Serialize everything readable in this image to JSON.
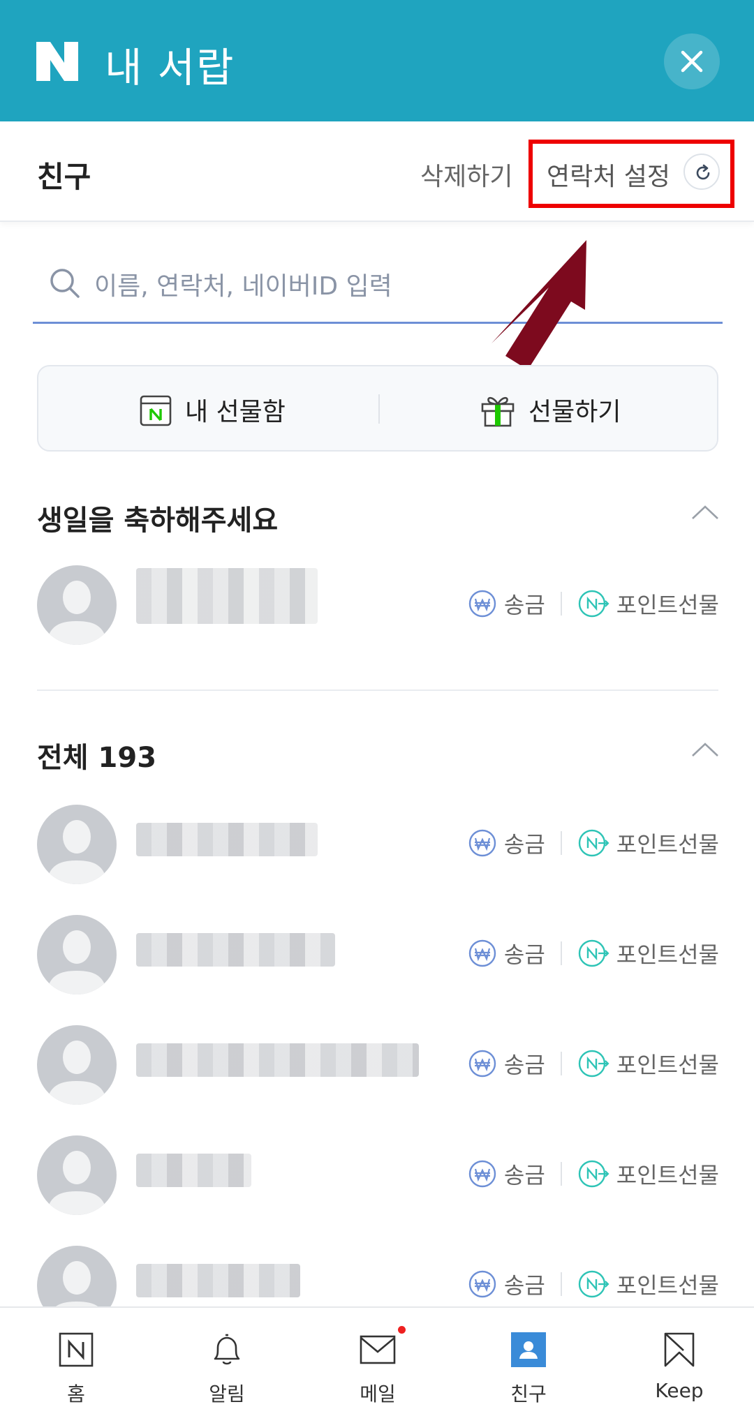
{
  "header": {
    "title": "내 서랍"
  },
  "subbar": {
    "label": "친구",
    "delete": "삭제하기",
    "contact_setting": "연락처 설정"
  },
  "search": {
    "placeholder": "이름, 연락처, 네이버ID 입력"
  },
  "giftbar": {
    "inbox": "내 선물함",
    "send": "선물하기"
  },
  "birthday": {
    "title": "생일을 축하해주세요"
  },
  "all": {
    "title": "전체 193"
  },
  "actions": {
    "send_money": "송금",
    "point_gift": "포인트선물"
  },
  "nav": [
    {
      "label": "홈"
    },
    {
      "label": "알림"
    },
    {
      "label": "메일"
    },
    {
      "label": "친구"
    },
    {
      "label": "Keep"
    }
  ],
  "colors": {
    "header": "#1fa4bf",
    "highlight": "#ee0000",
    "arrow": "#7d0a1e",
    "accent_blue": "#6d8fd6",
    "accent_teal": "#2ec4b6"
  }
}
